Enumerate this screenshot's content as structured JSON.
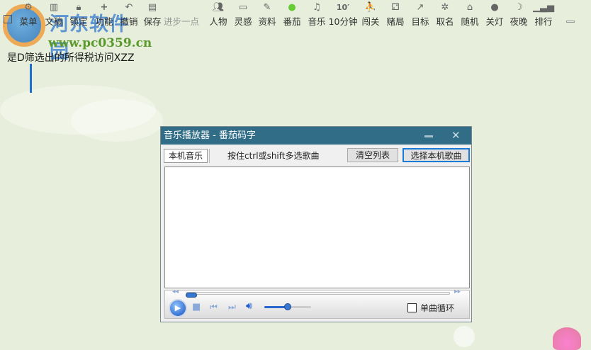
{
  "toolbar": {
    "items": [
      {
        "label": "菜单",
        "icon": "gear-icon"
      },
      {
        "label": "文稿",
        "icon": "book-icon"
      },
      {
        "label": "锁定",
        "icon": "lock-icon"
      },
      {
        "label": "功能",
        "icon": "plus-icon"
      },
      {
        "label": "撤销",
        "icon": "undo-icon"
      },
      {
        "label": "保存",
        "icon": "save-icon"
      },
      {
        "label": "进步一点",
        "icon": ""
      },
      {
        "label": "人物",
        "icon": "people-icon"
      },
      {
        "label": "灵感",
        "icon": "note-icon"
      },
      {
        "label": "资料",
        "icon": "pen-icon"
      },
      {
        "label": "番茄",
        "icon": "tomato-icon"
      },
      {
        "label": "音乐",
        "icon": "music-icon"
      },
      {
        "label": "10分钟",
        "icon": "timer-icon"
      },
      {
        "label": "闯关",
        "icon": "climb-icon"
      },
      {
        "label": "赌局",
        "icon": "dice-icon"
      },
      {
        "label": "目标",
        "icon": "target-icon"
      },
      {
        "label": "取名",
        "icon": "name-icon"
      },
      {
        "label": "随机",
        "icon": "random-icon"
      },
      {
        "label": "关灯",
        "icon": "bulb-icon"
      },
      {
        "label": "夜晚",
        "icon": "moon-icon"
      },
      {
        "label": "排行",
        "icon": "rank-icon"
      }
    ]
  },
  "watermark": {
    "name": "河东软件园",
    "url": "www.pc0359.cn"
  },
  "document": {
    "text": "是D筛选出的所得税访问XZZ"
  },
  "player": {
    "title": "音乐播放器 - 番茄码字",
    "tab": "本机音乐",
    "hint": "按住ctrl或shift多选歌曲",
    "clear_label": "清空列表",
    "choose_label": "选择本机歌曲",
    "loop_label": "单曲循环",
    "loop_checked": false,
    "progress": 0,
    "volume": 0.5
  }
}
